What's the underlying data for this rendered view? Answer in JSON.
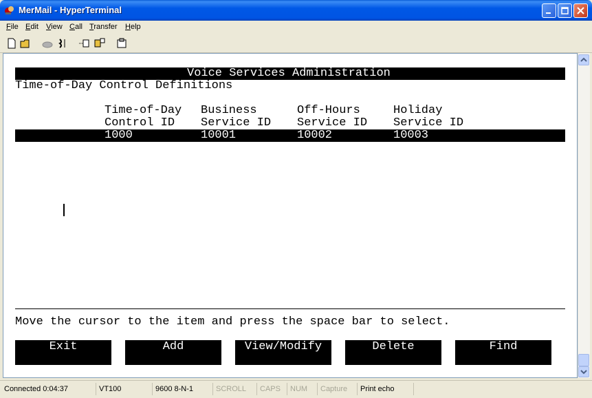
{
  "window": {
    "title": "MerMail - HyperTerminal"
  },
  "menu": [
    {
      "key": "F",
      "rest": "ile"
    },
    {
      "key": "E",
      "rest": "dit"
    },
    {
      "key": "V",
      "rest": "iew"
    },
    {
      "key": "C",
      "rest": "all"
    },
    {
      "key": "T",
      "rest": "ransfer"
    },
    {
      "key": "H",
      "rest": "elp"
    }
  ],
  "toolbar": {
    "icons": [
      "new-icon",
      "open-icon",
      "disconnect-icon",
      "dial-icon",
      "send-icon",
      "receive-icon",
      "properties-icon"
    ]
  },
  "terminal": {
    "header": "Voice Services Administration",
    "subtitle": "Time-of-Day Control Definitions",
    "columns": [
      {
        "line1": "Time-of-Day",
        "line2": "Control ID"
      },
      {
        "line1": "Business",
        "line2": "Service ID"
      },
      {
        "line1": "Off-Hours",
        "line2": "Service ID"
      },
      {
        "line1": "Holiday",
        "line2": "Service ID"
      }
    ],
    "rows": [
      {
        "control_id": "1000",
        "business": "10001",
        "off_hours": "10002",
        "holiday": "10003"
      }
    ],
    "prompt": "Move the cursor to the item and press the space bar to select.",
    "fkeys": [
      "Exit",
      "Add",
      "View/Modify",
      "Delete",
      "Find"
    ]
  },
  "status": {
    "connected": "Connected 0:04:37",
    "emulation": "VT100",
    "settings": "9600 8-N-1",
    "scroll": "SCROLL",
    "caps": "CAPS",
    "num": "NUM",
    "capture": "Capture",
    "print_echo": "Print echo"
  }
}
